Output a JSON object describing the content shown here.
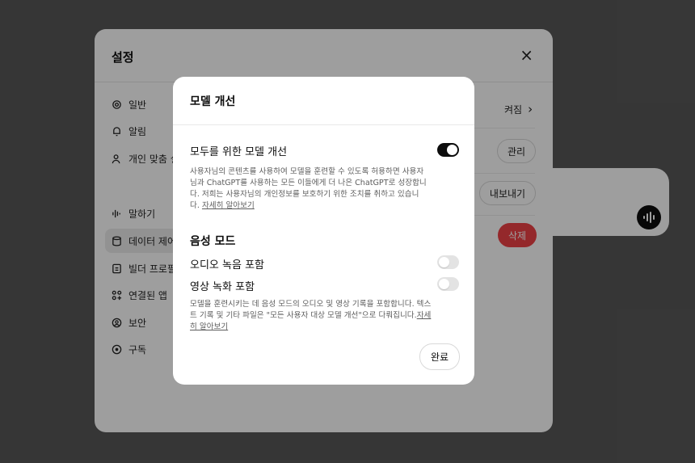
{
  "settings": {
    "title": "설정",
    "nav": [
      {
        "label": "일반",
        "icon": "gear-icon"
      },
      {
        "label": "알림",
        "icon": "bell-icon"
      },
      {
        "label": "개인 맞춤 설정",
        "icon": "person-icon"
      },
      {
        "label": "말하기",
        "icon": "waveform-icon"
      },
      {
        "label": "데이터 제어",
        "icon": "database-icon",
        "active": true
      },
      {
        "label": "빌더 프로필",
        "icon": "id-card-icon"
      },
      {
        "label": "연결된 앱",
        "icon": "apps-icon"
      },
      {
        "label": "보안",
        "icon": "shield-icon"
      },
      {
        "label": "구독",
        "icon": "subscription-icon"
      }
    ],
    "right": {
      "toggle_state_label": "켜짐",
      "manage_label": "관리",
      "export_label": "내보내기",
      "delete_label": "삭제"
    }
  },
  "modal": {
    "title": "모델 개선",
    "improve_label": "모두를 위한 모델 개선",
    "improve_on": true,
    "improve_desc": "사용자님의 콘텐츠를 사용하여 모델을 훈련할 수 있도록 허용하면 사용자님과 ChatGPT를 사용하는 모든 이들에게 더 나은 ChatGPT로 성장합니다. 저희는 사용자님의 개인정보를 보호하기 위한 조치를 취하고 있습니다.",
    "improve_link": "자세히 알아보기",
    "voice_title": "음성 모드",
    "audio_label": "오디오 녹음 포함",
    "audio_on": false,
    "video_label": "영상 녹화 포함",
    "video_on": false,
    "voice_desc": "모델을 훈련시키는 데 음성 모드의 오디오 및 영상 기록을 포함합니다. 텍스트 기록 및 기타 파일은 \"모든 사용자 대상 모델 개선\"으로 다뤄집니다.",
    "voice_link": "자세히 알아보기",
    "done_label": "완료"
  },
  "colors": {
    "accent_dark": "#0d0d0d",
    "danger": "#ef4146",
    "backdrop": "#585858"
  }
}
